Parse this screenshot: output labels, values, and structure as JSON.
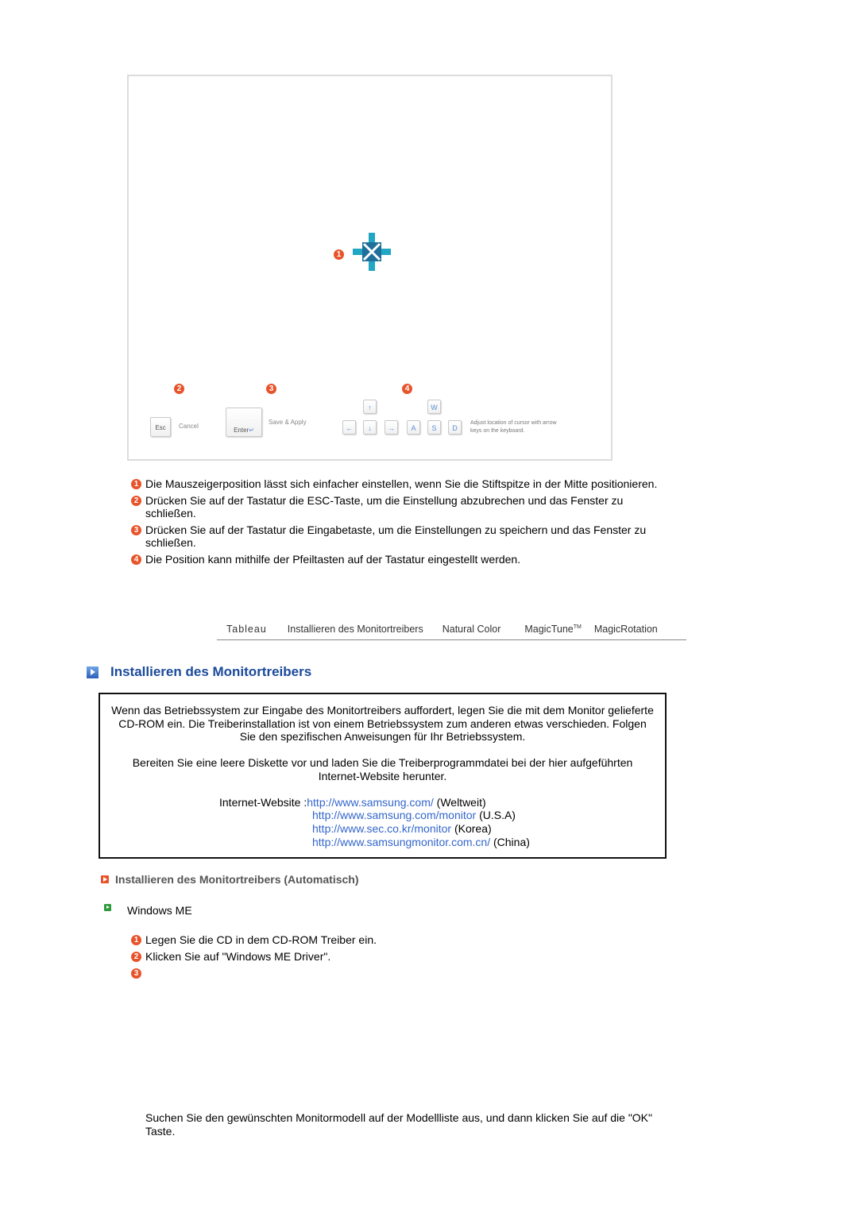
{
  "screenshot": {
    "callouts": [
      "1",
      "2",
      "3",
      "4"
    ],
    "keys": {
      "esc": "Esc",
      "esc_label": "Cancel",
      "enter": "Enter",
      "enter_label": "Save & Apply",
      "arrow_up": "↑",
      "arrow_left": "←",
      "arrow_down": "↓",
      "arrow_right": "→",
      "w": "W",
      "a": "A",
      "s": "S",
      "d": "D",
      "adjust_label_1": "Adjust location of cursor with arrow",
      "adjust_label_2": "keys on the keyboard."
    }
  },
  "steps_top": [
    {
      "num": "1",
      "text": "Die Mauszeigerposition lässt sich einfacher einstellen, wenn Sie die Stiftspitze in der Mitte positionieren."
    },
    {
      "num": "2",
      "text": "Drücken Sie auf der Tastatur die ESC-Taste, um die Einstellung abzubrechen und das Fenster zu schließen."
    },
    {
      "num": "3",
      "text": "Drücken Sie auf der Tastatur die Eingabetaste, um die Einstellungen zu speichern und das Fenster zu schließen."
    },
    {
      "num": "4",
      "text": "Die Position kann mithilfe der Pfeiltasten auf der Tastatur eingestellt werden."
    }
  ],
  "nav": {
    "items": [
      "Tableau",
      "Installieren des Monitortreibers",
      "Natural Color",
      "MagicTune",
      "MagicRotation"
    ],
    "tm": "TM"
  },
  "section_title": "Installieren des Monitortreibers",
  "infobox": {
    "para1": "Wenn das Betriebssystem zur Eingabe des Monitortreibers auffordert, legen Sie die mit dem Monitor gelieferte CD-ROM ein. Die Treiberinstallation ist von einem Betriebssystem zum anderen etwas verschieden. Folgen Sie den spezifischen Anweisungen für Ihr Betriebssystem.",
    "para2": "Bereiten Sie eine leere Diskette vor und laden Sie die Treiberprogrammdatei bei der hier aufgeführten Internet-Website herunter.",
    "website_label": "Internet-Website :",
    "sites": [
      {
        "url": "http://www.samsung.com/",
        "region": "(Weltweit)"
      },
      {
        "url": "http://www.samsung.com/monitor",
        "region": "(U.S.A)"
      },
      {
        "url": "http://www.sec.co.kr/monitor",
        "region": "(Korea)"
      },
      {
        "url": "http://www.samsungmonitor.com.cn/",
        "region": "(China)"
      }
    ]
  },
  "subsection_title": "Installieren des Monitortreibers (Automatisch)",
  "os_label": "Windows ME",
  "steps_bottom": [
    {
      "num": "1",
      "text": "Legen Sie die CD in dem CD-ROM Treiber ein."
    },
    {
      "num": "2",
      "text": "Klicken Sie auf \"Windows ME Driver\"."
    },
    {
      "num": "3",
      "text": ""
    }
  ],
  "final_text": "Suchen Sie den gewünschten Monitormodell auf der Modellliste aus, und dann klicken Sie auf die \"OK\" Taste."
}
